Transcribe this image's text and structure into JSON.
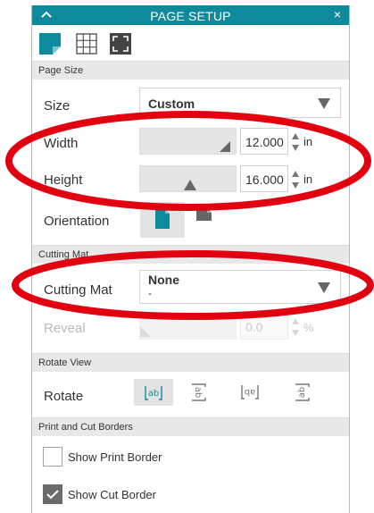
{
  "window": {
    "title": "PAGE SETUP",
    "close_glyph": "×"
  },
  "tabs": [
    {
      "icon": "page-setup-icon",
      "active": true
    },
    {
      "icon": "grid-icon",
      "active": false
    },
    {
      "icon": "bleed-icon",
      "active": false
    }
  ],
  "page_size": {
    "section": "Page Size",
    "size_label": "Size",
    "size_value": "Custom",
    "width_label": "Width",
    "width_value": "12.000",
    "width_unit": "in",
    "height_label": "Height",
    "height_value": "16.000",
    "height_unit": "in",
    "orientation_label": "Orientation"
  },
  "cutting_mat": {
    "section": "Cutting Mat",
    "mat_label": "Cutting Mat",
    "mat_value": "None",
    "mat_subvalue": "-",
    "reveal_label": "Reveal",
    "reveal_value": "0.0",
    "reveal_unit": "%"
  },
  "rotate_view": {
    "section": "Rotate View",
    "rotate_label": "Rotate"
  },
  "borders": {
    "section": "Print and Cut Borders",
    "print_border_label": "Show Print Border",
    "print_border_checked": false,
    "cut_border_label": "Show Cut Border",
    "cut_border_checked": true
  },
  "colors": {
    "accent": "#0f8a9d",
    "annotation": "#e20010"
  }
}
